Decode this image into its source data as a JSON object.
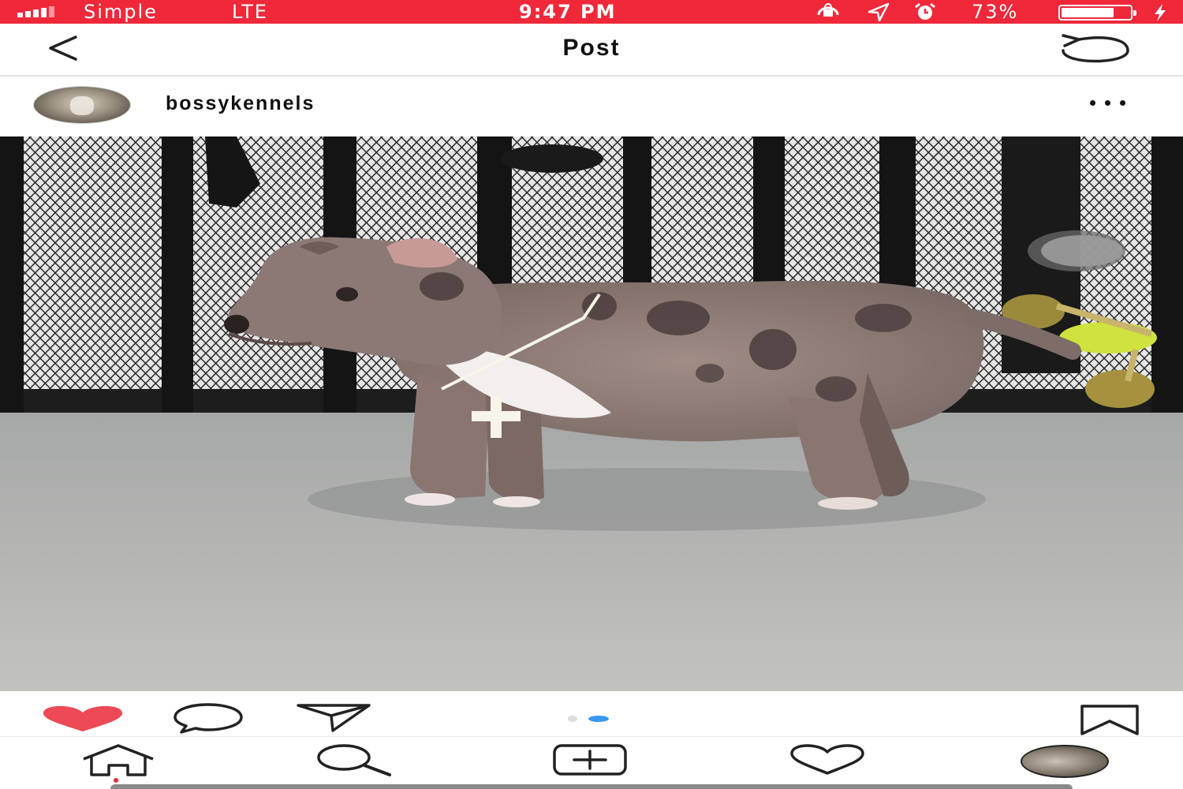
{
  "status_bar": {
    "carrier": "Simple",
    "network": "LTE",
    "time": "9:47 PM",
    "battery_percent": "73%",
    "battery_level": 0.73,
    "background_color": "#f0283a",
    "icons": [
      "signal-icon",
      "lock-rotation-icon",
      "location-icon",
      "alarm-icon",
      "battery-icon",
      "charging-icon"
    ]
  },
  "nav": {
    "title": "Post",
    "back_icon": "chevron-left-icon",
    "refresh_icon": "refresh-icon"
  },
  "post": {
    "username": "bossykennels",
    "more_icon": "more-dots-icon",
    "media_kind": "video",
    "carousel": {
      "count": 2,
      "active_index": 1
    },
    "liked": true,
    "accent_color": "#3897f0",
    "like_color": "#ed4956"
  },
  "tab_bar": {
    "items": [
      "home-icon",
      "search-icon",
      "add-post-icon",
      "activity-heart-icon",
      "profile-avatar"
    ],
    "notification_color": "#f0283a"
  }
}
